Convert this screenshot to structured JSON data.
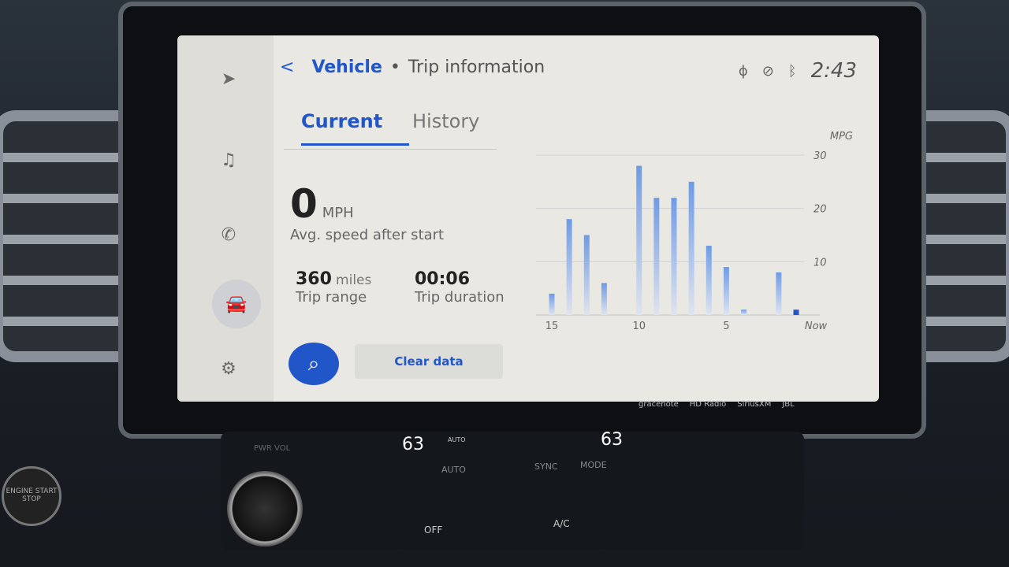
{
  "header": {
    "back": "<",
    "section": "Vehicle",
    "separator": "•",
    "title": "Trip information",
    "clock": "2:43"
  },
  "status_icons": [
    "wireless-charging-icon",
    "voice-muted-icon",
    "bluetooth-icon"
  ],
  "sidebar": {
    "items": [
      {
        "icon": "navigation-icon"
      },
      {
        "icon": "music-icon"
      },
      {
        "icon": "phone-icon"
      },
      {
        "icon": "car-icon",
        "active": true
      },
      {
        "icon": "gear-icon"
      }
    ]
  },
  "tabs": [
    {
      "label": "Current",
      "active": true
    },
    {
      "label": "History",
      "active": false
    }
  ],
  "stats": {
    "avg_speed": {
      "value": "0",
      "unit": "MPH",
      "label": "Avg. speed after start"
    },
    "range": {
      "value": "360",
      "unit": "miles",
      "label": "Trip range"
    },
    "duration": {
      "value": "00:06",
      "label": "Trip duration"
    }
  },
  "actions": {
    "clear": "Clear data",
    "search_icon": "search-icon"
  },
  "accent": "#2156c9",
  "chart_data": {
    "type": "bar",
    "ylabel": "MPG",
    "ylim": [
      0,
      30
    ],
    "yticks": [
      "10",
      "20",
      "30"
    ],
    "xticks": [
      "15",
      "10",
      "5",
      "Now"
    ],
    "grid": true,
    "categories": [
      15,
      14,
      13,
      12,
      11,
      10,
      9,
      8,
      7,
      6,
      5,
      4,
      3,
      2,
      1
    ],
    "values": [
      4,
      18,
      15,
      6,
      0,
      28,
      22,
      22,
      25,
      13,
      9,
      1,
      0,
      8,
      1
    ]
  },
  "console": {
    "left_temp": "63",
    "right_temp": "63",
    "auto": "AUTO",
    "sync": "SYNC",
    "mode": "MODE",
    "off": "OFF",
    "ac": "A/C",
    "engine": "ENGINE START STOP",
    "pwr": "PWR VOL"
  },
  "brand_logos": [
    "gracenote",
    "HD Radio",
    "SiriusXM",
    "JBL"
  ]
}
